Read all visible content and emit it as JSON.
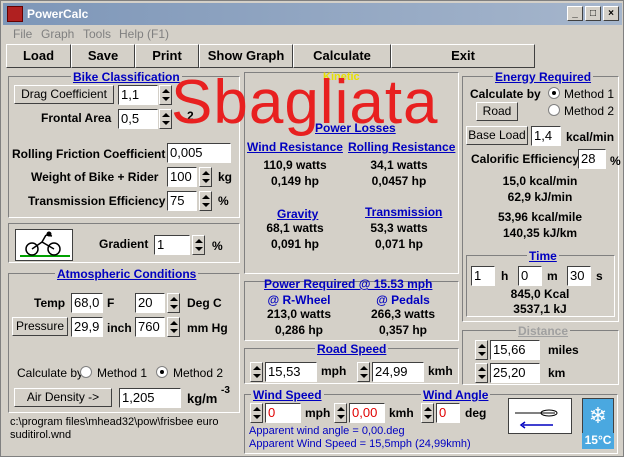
{
  "window": {
    "title": "PowerCalc"
  },
  "menu": [
    "File",
    "Graph",
    "Tools",
    "Help (F1)"
  ],
  "toolbar": {
    "load": "Load",
    "save": "Save",
    "print": "Print",
    "show_graph": "Show Graph",
    "calculate": "Calculate",
    "exit": "Exit"
  },
  "bike": {
    "title": "Bike Classification",
    "drag_btn": "Drag Coefficient",
    "drag_val": "1,1",
    "frontal_lbl": "Frontal Area",
    "frontal_val": "0,5",
    "frontal_unit": "2",
    "rolling_lbl": "Rolling Friction Coefficient",
    "rolling_val": "0,005",
    "weight_lbl": "Weight of Bike + Rider",
    "weight_val": "100",
    "weight_unit": "kg",
    "trans_lbl": "Transmission Efficiency",
    "trans_val": "75",
    "trans_unit": "%"
  },
  "gradient": {
    "label": "Gradient",
    "value": "1",
    "unit": "%"
  },
  "atmo": {
    "title": "Atmospheric Conditions",
    "temp_lbl": "Temp",
    "temp_f": "68,0",
    "unit_f": "F",
    "temp_c": "20",
    "unit_c": "Deg C",
    "pressure_btn": "Pressure",
    "pressure_inch": "29,9",
    "unit_inch": "inch",
    "pressure_mm": "760",
    "unit_mm": "mm Hg",
    "calc_lbl": "Calculate by",
    "method1": "Method 1",
    "method2": "Method 2",
    "density_btn": "Air Density ->",
    "density_val": "1,205",
    "density_unit": "kg/m",
    "density_exp": "-3"
  },
  "filepath": "c:\\program files\\mhead32\\pow\\frisbee euro suditirol.wnd",
  "power_losses": {
    "title": "Power Losses",
    "kinetic": "Kinetic",
    "wind_title": "Wind Resistance",
    "wind_w": "110,9 watts",
    "wind_hp": "0,149 hp",
    "roll_title": "Rolling Resistance",
    "roll_w": "34,1 watts",
    "roll_hp": "0,0457 hp",
    "grav_title": "Gravity",
    "grav_w": "68,1 watts",
    "grav_hp": "0,091 hp",
    "trans_title": "Transmission",
    "trans_w": "53,3 watts",
    "trans_hp": "0,071 hp"
  },
  "power_req": {
    "title": "Power Required @  15.53 mph",
    "rwheel": "@ R-Wheel",
    "pedals": "@ Pedals",
    "rw_w": "213,0 watts",
    "rw_hp": "0,286 hp",
    "pd_w": "266,3 watts",
    "pd_hp": "0,357 hp"
  },
  "road_speed": {
    "title": "Road Speed",
    "mph_val": "15,53",
    "mph": "mph",
    "kmh_val": "24,99",
    "kmh": "kmh"
  },
  "wind": {
    "speed_title": "Wind Speed",
    "angle_title": "Wind Angle",
    "mph_val": "0",
    "mph": "mph",
    "kmh_val": "0,00",
    "kmh": "kmh",
    "angle_val": "0",
    "deg": "deg",
    "apparent_angle": "Apparent wind angle = 0,00.deg",
    "apparent_speed": "Apparent Wind Speed = 15,5mph (24,99kmh)",
    "temp_badge": "15°C"
  },
  "energy": {
    "title": "Energy Required",
    "calc_by": "Calculate by",
    "method1": "Method 1",
    "method2": "Method 2",
    "road_btn": "Road",
    "baseload_btn": "Base Load",
    "baseload_val": "1,4",
    "baseload_unit": "kcal/min",
    "calorific_lbl": "Calorific Efficiency",
    "calorific_val": "28",
    "calorific_unit": "%",
    "kcal_min": "15,0 kcal/min",
    "kj_min": "62,9 kJ/min",
    "kcal_mile": "53,96 kcal/mile",
    "kj_km": "140,35 kJ/km"
  },
  "time": {
    "title": "Time",
    "h_val": "1",
    "h": "h",
    "m_val": "0",
    "m": "m",
    "s_val": "30",
    "s": "s",
    "kcal": "845,0 Kcal",
    "kj": "3537,1 kJ"
  },
  "distance": {
    "title": "Distance",
    "miles_val": "15,66",
    "miles": "miles",
    "km_val": "25,20",
    "km": "km"
  },
  "watermark": "Sbagliata",
  "colors": {
    "accent": "#0000c0",
    "watermark": "#e82020",
    "title_bar": "#7d96b8"
  }
}
